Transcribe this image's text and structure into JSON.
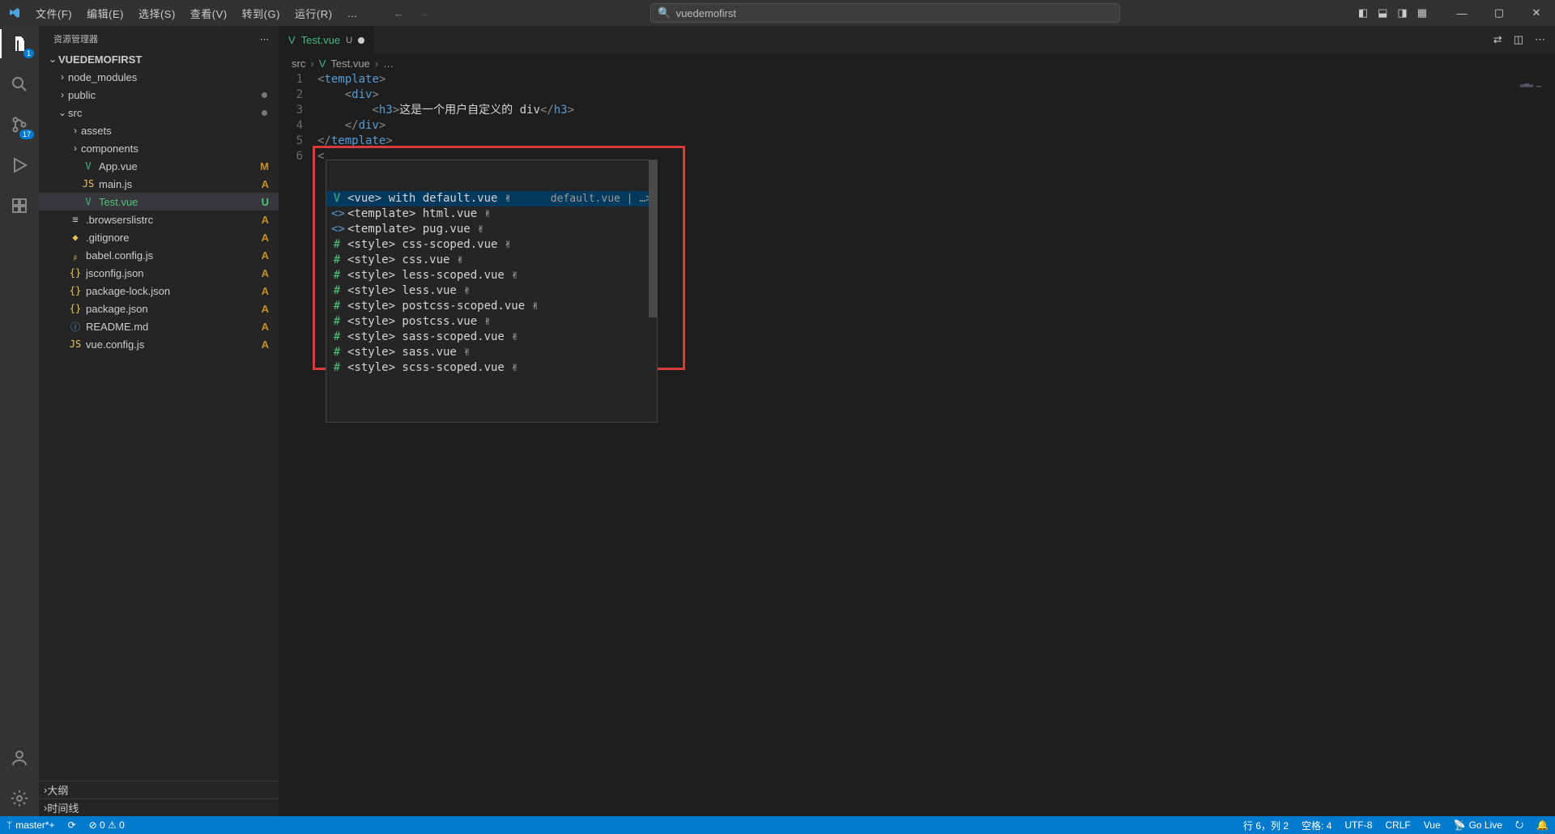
{
  "menu": {
    "file": "文件(F)",
    "edit": "编辑(E)",
    "select": "选择(S)",
    "view": "查看(V)",
    "goto": "转到(G)",
    "run": "运行(R)",
    "more": "…"
  },
  "search_placeholder": "vuedemofirst",
  "activity": {
    "explorer_badge": "1",
    "scm_badge": "17"
  },
  "sidebar": {
    "title": "资源管理器",
    "root": "VUEDEMOFIRST",
    "items": [
      {
        "label": "node_modules",
        "kind": "folder"
      },
      {
        "label": "public",
        "kind": "folder",
        "dot": true
      },
      {
        "label": "src",
        "kind": "folder",
        "open": true,
        "dot": true
      },
      {
        "label": "assets",
        "kind": "folder",
        "indent": 2
      },
      {
        "label": "components",
        "kind": "folder",
        "indent": 2
      },
      {
        "label": "App.vue",
        "kind": "file",
        "icon": "V",
        "iconcls": "vue-green",
        "indent": 2,
        "status": "M"
      },
      {
        "label": "main.js",
        "kind": "file",
        "icon": "JS",
        "iconcls": "js-yellow",
        "indent": 2,
        "status": "A"
      },
      {
        "label": "Test.vue",
        "kind": "file",
        "icon": "V",
        "iconcls": "vue-green",
        "indent": 2,
        "status": "U",
        "selected": true,
        "untracked": true
      },
      {
        "label": ".browserslistrc",
        "kind": "file",
        "icon": "≡",
        "iconcls": "",
        "status": "A"
      },
      {
        "label": ".gitignore",
        "kind": "file",
        "icon": "◆",
        "iconcls": "js-yellow",
        "status": "A"
      },
      {
        "label": "babel.config.js",
        "kind": "file",
        "icon": "ᵦ",
        "iconcls": "js-yellow",
        "status": "A"
      },
      {
        "label": "jsconfig.json",
        "kind": "file",
        "icon": "{}",
        "iconcls": "json-yellow",
        "status": "A"
      },
      {
        "label": "package-lock.json",
        "kind": "file",
        "icon": "{}",
        "iconcls": "json-yellow",
        "status": "A"
      },
      {
        "label": "package.json",
        "kind": "file",
        "icon": "{}",
        "iconcls": "json-yellow",
        "status": "A"
      },
      {
        "label": "README.md",
        "kind": "file",
        "icon": "ⓘ",
        "iconcls": "readme-blue",
        "status": "A"
      },
      {
        "label": "vue.config.js",
        "kind": "file",
        "icon": "JS",
        "iconcls": "js-yellow",
        "status": "A"
      }
    ],
    "outline": "大纲",
    "timeline": "时间线"
  },
  "tab": {
    "name": "Test.vue",
    "status": "U"
  },
  "breadcrumb": {
    "a": "src",
    "b": "Test.vue",
    "c": "…"
  },
  "code": {
    "l1a": "<",
    "l1b": "template",
    "l1c": ">",
    "l2a": "<",
    "l2b": "div",
    "l2c": ">",
    "l3a": "<",
    "l3b": "h3",
    "l3c": ">",
    "l3txt": "这是一个用户自定义的 div",
    "l3d": "</",
    "l3e": "h3",
    "l3f": ">",
    "l4a": "</",
    "l4b": "div",
    "l4c": ">",
    "l5a": "</",
    "l5b": "template",
    "l5c": ">",
    "l6a": "<"
  },
  "lines": {
    "1": "1",
    "2": "2",
    "3": "3",
    "4": "4",
    "5": "5",
    "6": "6"
  },
  "suggest": {
    "detail": "default.vue | …>",
    "items": [
      {
        "icon": "V",
        "iconcls": "sug-vue",
        "text": "<vue> with default.vue ✌",
        "sel": true
      },
      {
        "icon": "<>",
        "iconcls": "sug-tag",
        "text": "<template> html.vue ✌"
      },
      {
        "icon": "<>",
        "iconcls": "sug-tag",
        "text": "<template> pug.vue ✌"
      },
      {
        "icon": "#",
        "iconcls": "sug-hash",
        "text": "<style> css-scoped.vue ✌"
      },
      {
        "icon": "#",
        "iconcls": "sug-hash",
        "text": "<style> css.vue ✌"
      },
      {
        "icon": "#",
        "iconcls": "sug-hash",
        "text": "<style> less-scoped.vue ✌"
      },
      {
        "icon": "#",
        "iconcls": "sug-hash",
        "text": "<style> less.vue ✌"
      },
      {
        "icon": "#",
        "iconcls": "sug-hash",
        "text": "<style> postcss-scoped.vue ✌"
      },
      {
        "icon": "#",
        "iconcls": "sug-hash",
        "text": "<style> postcss.vue ✌"
      },
      {
        "icon": "#",
        "iconcls": "sug-hash",
        "text": "<style> sass-scoped.vue ✌"
      },
      {
        "icon": "#",
        "iconcls": "sug-hash",
        "text": "<style> sass.vue ✌"
      },
      {
        "icon": "#",
        "iconcls": "sug-hash",
        "text": "<style> scss-scoped.vue ✌"
      }
    ]
  },
  "status": {
    "branch": "master*+",
    "sync": "⟳",
    "errwarn": "⊘ 0 ⚠ 0",
    "pos": "行 6，列 2",
    "spaces": "空格: 4",
    "encoding": "UTF-8",
    "eol": "CRLF",
    "lang": "Vue",
    "golive": "Go Live",
    "feedback": "⭮",
    "bell": "🔔"
  }
}
